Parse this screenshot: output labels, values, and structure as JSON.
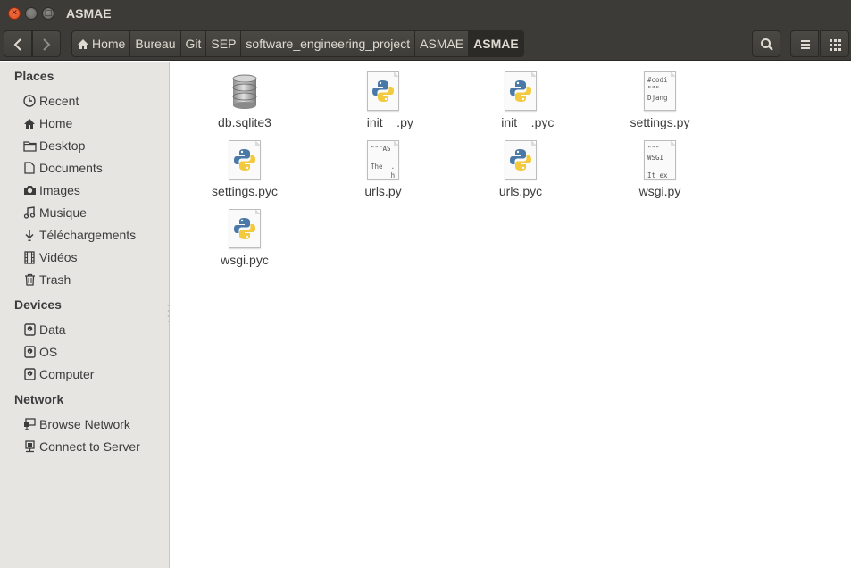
{
  "window": {
    "title": "ASMAE"
  },
  "breadcrumb": [
    "Home",
    "Bureau",
    "Git",
    "SEP",
    "software_engineering_project",
    "ASMAE",
    "ASMAE"
  ],
  "sidebar": {
    "places_header": "Places",
    "places": [
      "Recent",
      "Home",
      "Desktop",
      "Documents",
      "Images",
      "Musique",
      "Téléchargements",
      "Vidéos",
      "Trash"
    ],
    "devices_header": "Devices",
    "devices": [
      "Data",
      "OS",
      "Computer"
    ],
    "network_header": "Network",
    "network": [
      "Browse Network",
      "Connect to Server"
    ]
  },
  "files": [
    {
      "name": "db.sqlite3",
      "icon": "database-icon"
    },
    {
      "name": "__init__.py",
      "icon": "python-icon"
    },
    {
      "name": "__init__.pyc",
      "icon": "python-icon"
    },
    {
      "name": "settings.py",
      "icon": "text-file-icon",
      "preview": "#codi\n\"\"\"\nDjang"
    },
    {
      "name": "settings.pyc",
      "icon": "python-icon"
    },
    {
      "name": "urls.py",
      "icon": "text-file-icon",
      "preview": "\"\"\"AS\n\nThe  .\n     h"
    },
    {
      "name": "urls.pyc",
      "icon": "python-icon"
    },
    {
      "name": "wsgi.py",
      "icon": "text-file-icon",
      "preview": "\"\"\"\nWSGI\n\nIt ex"
    },
    {
      "name": "wsgi.pyc",
      "icon": "python-icon"
    }
  ],
  "colors": {
    "titlebar": "#3c3b37",
    "sidebar": "#e6e5e2",
    "close": "#df4a16"
  }
}
